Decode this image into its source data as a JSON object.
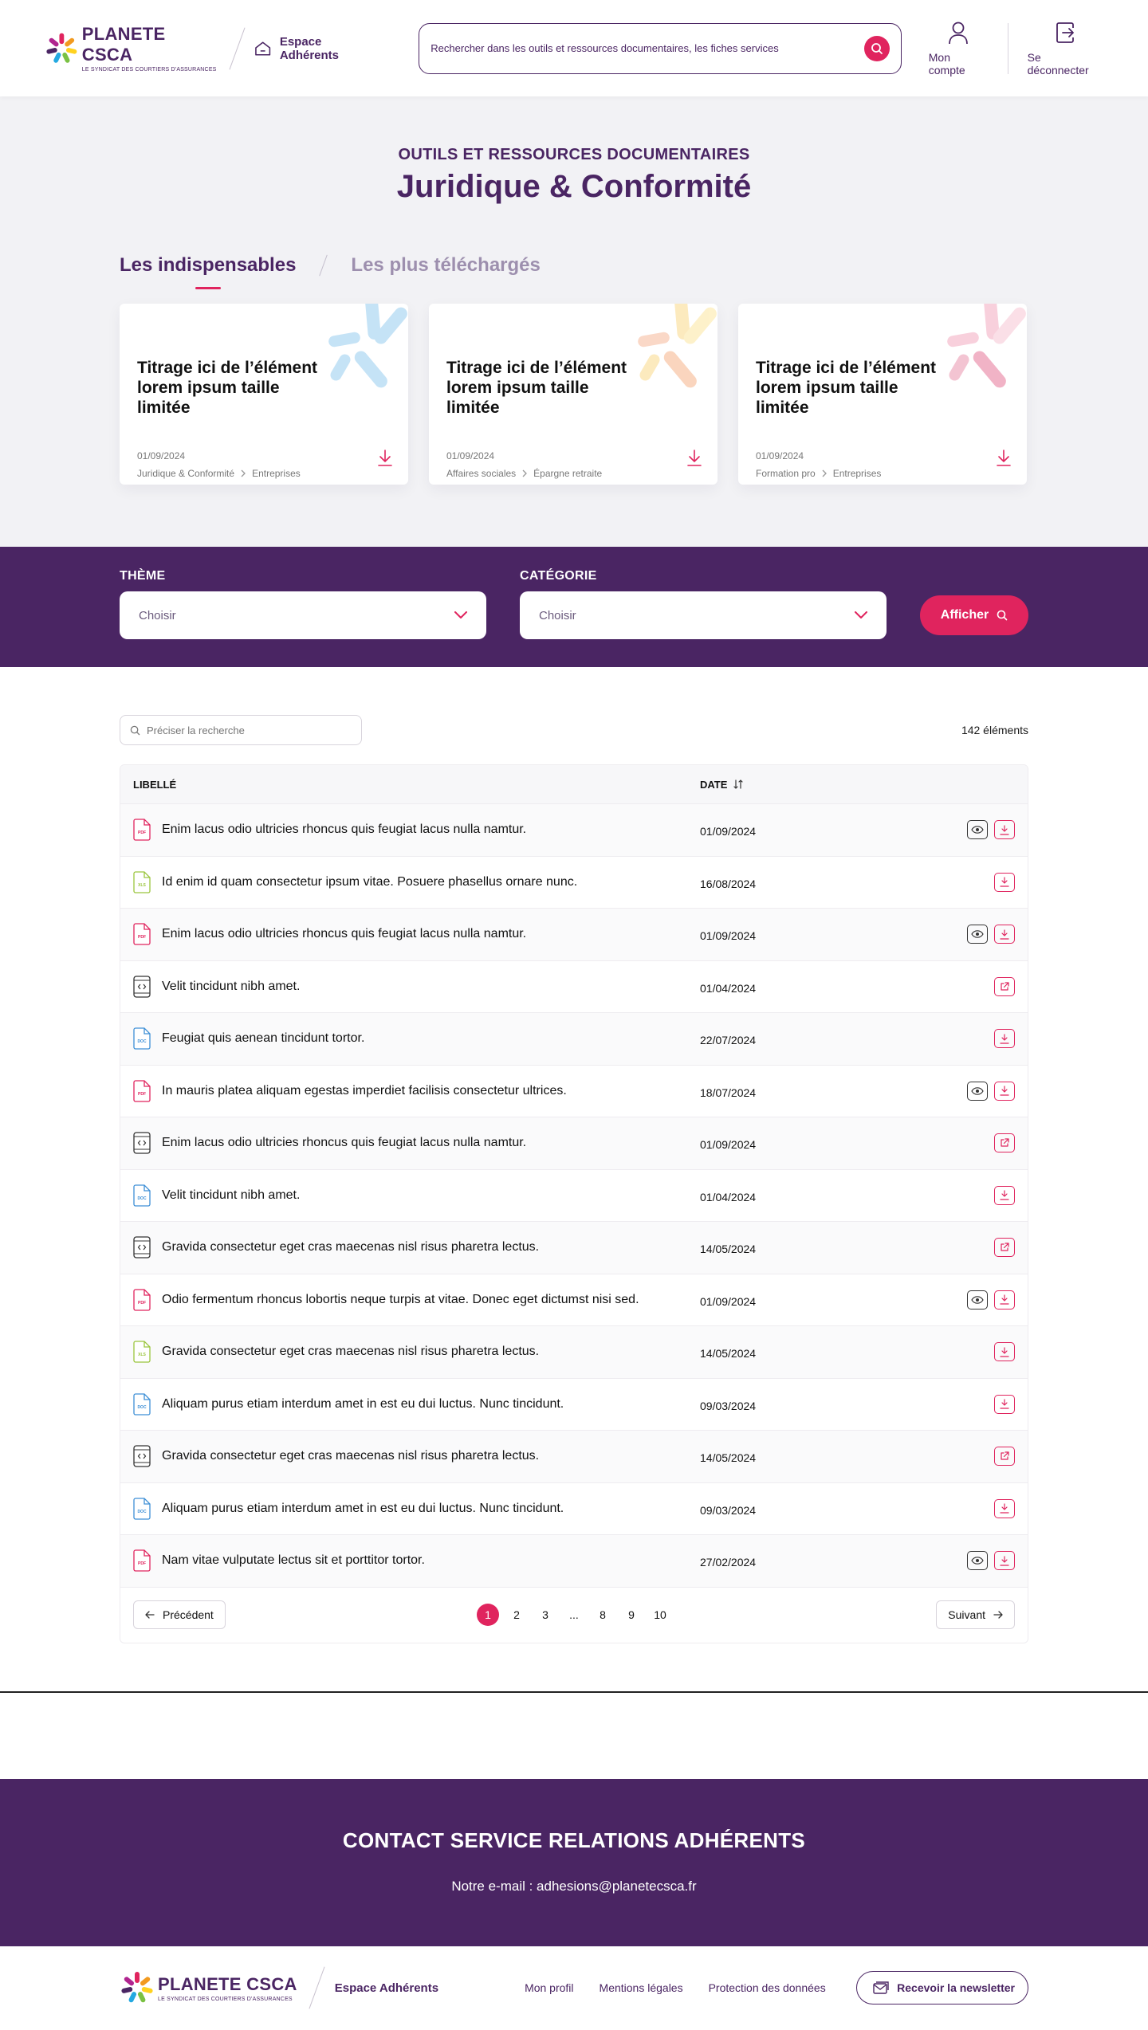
{
  "header": {
    "logo_name": "PLANETE CSCA",
    "logo_sub": "LE SYNDICAT DES COURTIERS D'ASSURANCES",
    "espace_label": "Espace Adhérents",
    "search_placeholder": "Rechercher dans les outils et ressources documentaires, les fiches services",
    "account_label": "Mon compte",
    "logout_label": "Se déconnecter"
  },
  "hero": {
    "kicker": "OUTILS ET RESSOURCES DOCUMENTAIRES",
    "title": "Juridique & Conformité",
    "tabs": [
      {
        "label": "Les indispensables",
        "active": true
      },
      {
        "label": "Les plus téléchargés",
        "active": false
      }
    ],
    "cards": [
      {
        "title": "Titrage ici de l’élément lorem ipsum taille limitée",
        "date": "01/09/2024",
        "crumb1": "Juridique & Conformité",
        "crumb2": "Entreprises",
        "deco_color": "#9fd0f0"
      },
      {
        "title": "Titrage ici de l’élément lorem ipsum taille limitée",
        "date": "01/09/2024",
        "crumb1": "Affaires sociales",
        "crumb2": "Épargne retraite",
        "deco_color": "#fbd98a"
      },
      {
        "title": "Titrage ici de l’élément lorem ipsum taille limitée",
        "date": "01/09/2024",
        "crumb1": "Formation pro",
        "crumb2": "Entreprises",
        "deco_color": "#f3a3bb"
      }
    ]
  },
  "filters": {
    "theme_label": "THÈME",
    "theme_value": "Choisir",
    "category_label": "CATÉGORIE",
    "category_value": "Choisir",
    "submit_label": "Afficher"
  },
  "list": {
    "refine_placeholder": "Préciser la recherche",
    "count": "142 éléments",
    "col_label": "LIBELLÉ",
    "col_date": "DATE",
    "rows": [
      {
        "type": "PDF",
        "title": "Enim lacus odio ultricies rhoncus quis feugiat lacus nulla namtur.",
        "date": "01/09/2024",
        "action": "download",
        "view": true
      },
      {
        "type": "XLS",
        "title": "Id enim id quam consectetur ipsum vitae. Posuere phasellus ornare nunc.",
        "date": "16/08/2024",
        "action": "download",
        "view": false
      },
      {
        "type": "PDF",
        "title": "Enim lacus odio ultricies rhoncus quis feugiat lacus nulla namtur.",
        "date": "01/09/2024",
        "action": "download",
        "view": true
      },
      {
        "type": "CODE",
        "title": "Velit tincidunt nibh amet.",
        "date": "01/04/2024",
        "action": "external",
        "view": false
      },
      {
        "type": "DOC",
        "title": "Feugiat quis aenean tincidunt tortor.",
        "date": "22/07/2024",
        "action": "download",
        "view": false
      },
      {
        "type": "PDF",
        "title": "In mauris platea aliquam egestas imperdiet facilisis consectetur ultrices.",
        "date": "18/07/2024",
        "action": "download",
        "view": true
      },
      {
        "type": "CODE",
        "title": "Enim lacus odio ultricies rhoncus quis feugiat lacus nulla namtur.",
        "date": "01/09/2024",
        "action": "external",
        "view": false
      },
      {
        "type": "DOC",
        "title": "Velit tincidunt nibh amet.",
        "date": "01/04/2024",
        "action": "download",
        "view": false
      },
      {
        "type": "CODE",
        "title": "Gravida consectetur eget cras maecenas nisl risus pharetra lectus.",
        "date": "14/05/2024",
        "action": "external",
        "view": false
      },
      {
        "type": "PDF",
        "title": "Odio fermentum rhoncus lobortis neque turpis at vitae. Donec eget dictumst nisi sed.",
        "date": "01/09/2024",
        "action": "download",
        "view": true
      },
      {
        "type": "XLS",
        "title": "Gravida consectetur eget cras maecenas nisl risus pharetra lectus.",
        "date": "14/05/2024",
        "action": "download",
        "view": false
      },
      {
        "type": "DOC",
        "title": "Aliquam purus etiam interdum amet in est eu dui luctus. Nunc tincidunt.",
        "date": "09/03/2024",
        "action": "download",
        "view": false
      },
      {
        "type": "CODE",
        "title": "Gravida consectetur eget cras maecenas nisl risus pharetra lectus.",
        "date": "14/05/2024",
        "action": "external",
        "view": false
      },
      {
        "type": "DOC",
        "title": "Aliquam purus etiam interdum amet in est eu dui luctus. Nunc tincidunt.",
        "date": "09/03/2024",
        "action": "download",
        "view": false
      },
      {
        "type": "PDF",
        "title": "Nam vitae vulputate lectus sit et porttitor tortor.",
        "date": "27/02/2024",
        "action": "download",
        "view": true
      }
    ],
    "prev_label": "Précédent",
    "next_label": "Suivant",
    "pages": [
      "1",
      "2",
      "3",
      "...",
      "8",
      "9",
      "10"
    ],
    "current_page": "1"
  },
  "contact": {
    "title": "CONTACT SERVICE RELATIONS ADHÉRENTS",
    "mail": "Notre e-mail : adhesions@planetecsca.fr"
  },
  "footer": {
    "espace_label": "Espace Adhérents",
    "links": [
      "Mon profil",
      "Mentions légales",
      "Protection des données"
    ],
    "newsletter_label": "Recevoir la newsletter"
  },
  "colors": {
    "brand_purple": "#4a2563",
    "accent_pink": "#e0245e",
    "pdf": "#e0245e",
    "xls": "#9bc53d",
    "doc": "#3d8fd6",
    "code": "#333333"
  }
}
